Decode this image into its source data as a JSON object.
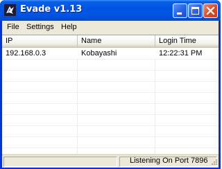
{
  "window": {
    "title": "Evade v1.13",
    "colors": {
      "titlebar": "#0054e3",
      "close_button": "#d3512c",
      "face": "#ece9d8"
    }
  },
  "icons": {
    "app": "app-icon",
    "minimize": "minimize-icon",
    "maximize": "maximize-icon",
    "close": "close-icon",
    "resize": "resize-grip-icon"
  },
  "menubar": {
    "items": [
      {
        "label": "File"
      },
      {
        "label": "Settings"
      },
      {
        "label": "Help"
      }
    ]
  },
  "list": {
    "columns": [
      {
        "label": "IP"
      },
      {
        "label": "Name"
      },
      {
        "label": "Login Time"
      }
    ],
    "rows": [
      {
        "ip": "192.168.0.3",
        "name": "Kobayashi",
        "login_time": "12:22:31 PM"
      }
    ]
  },
  "statusbar": {
    "text": "Listening On Port 7896"
  }
}
